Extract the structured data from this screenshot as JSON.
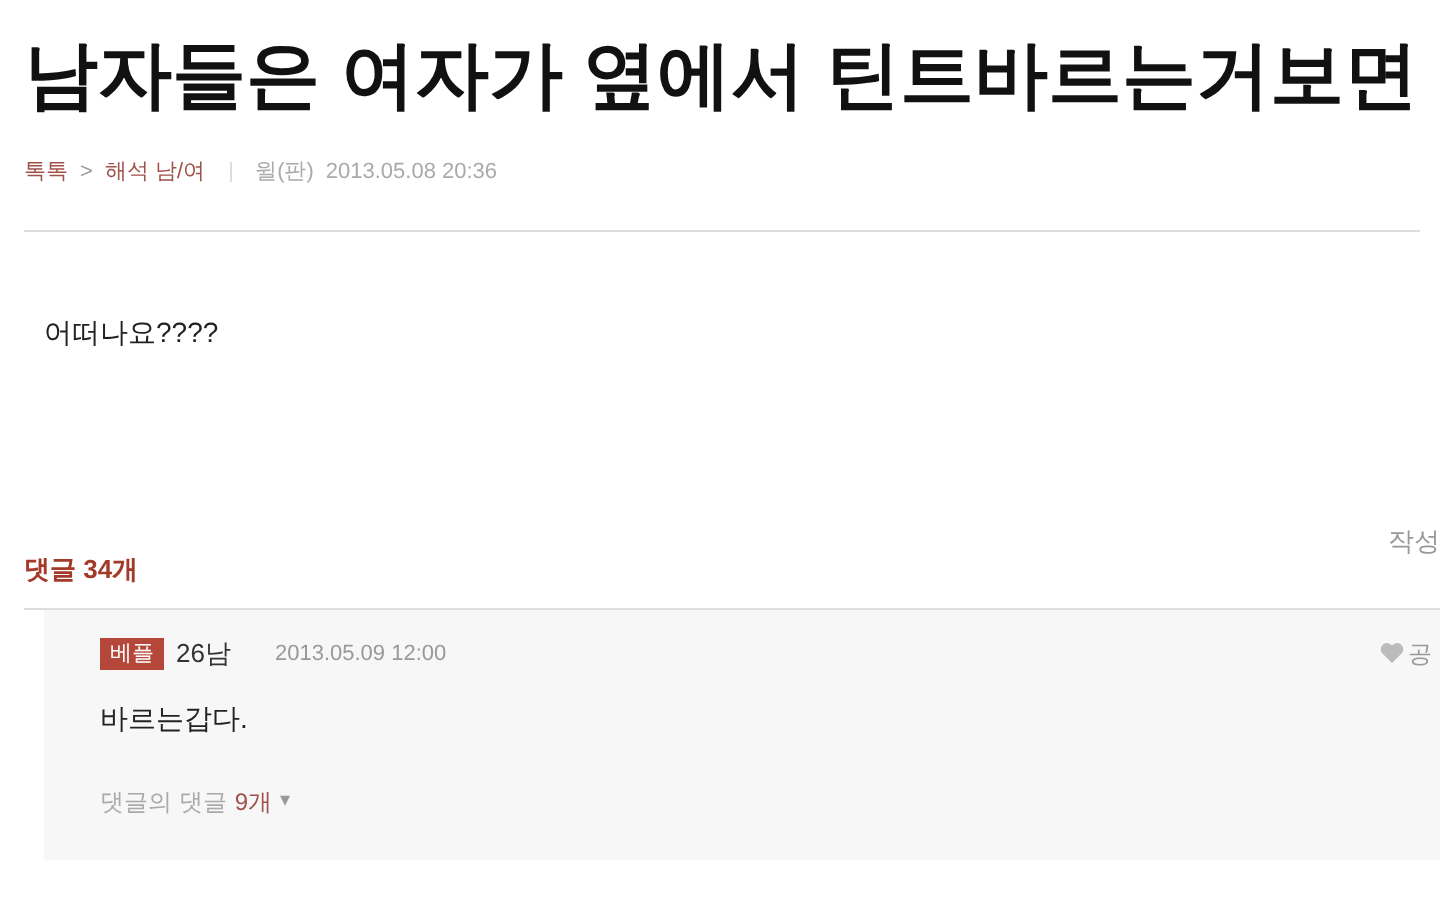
{
  "title": "남자들은 여자가 옆에서 틴트바르는거보면",
  "breadcrumb": {
    "category": "톡톡",
    "separator": ">",
    "board": "해석 남/여",
    "author": "윌(판)",
    "date": "2013.05.08 20:36"
  },
  "body": "어떠나요????",
  "comments": {
    "header": "댓글 34개",
    "sort": "작성",
    "items": [
      {
        "badge": "베플",
        "author": "26남",
        "date": "2013.05.09 12:00",
        "like": "공",
        "text": "바르는갑다.",
        "replies": "댓글의 댓글",
        "reply_count": "9개",
        "reply_caret": "▾"
      }
    ]
  }
}
